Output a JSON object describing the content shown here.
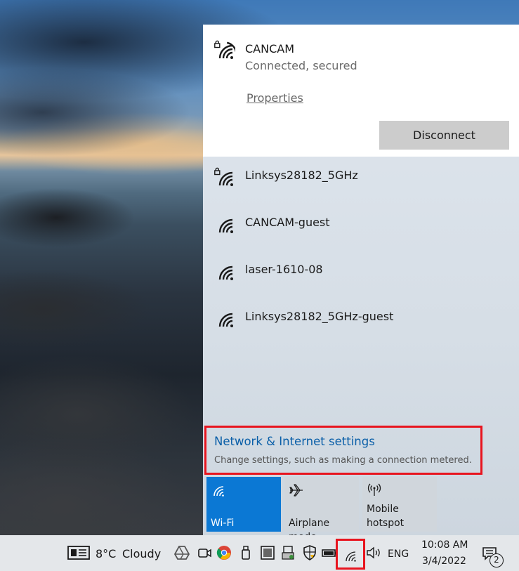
{
  "connected": {
    "ssid": "CANCAM",
    "status": "Connected, secured",
    "properties_label": "Properties",
    "disconnect_label": "Disconnect"
  },
  "networks": [
    {
      "ssid": "Linksys28182_5GHz",
      "secured": true
    },
    {
      "ssid": "CANCAM-guest",
      "secured": false
    },
    {
      "ssid": "laser-1610-08",
      "secured": false
    },
    {
      "ssid": "Linksys28182_5GHz-guest",
      "secured": false
    }
  ],
  "settings": {
    "title": "Network & Internet settings",
    "subtitle": "Change settings, such as making a connection metered."
  },
  "quick_actions": [
    {
      "label": "Wi-Fi",
      "label2": "",
      "icon": "wifi-icon",
      "active": true
    },
    {
      "label": "Airplane mode",
      "label2": "",
      "icon": "airplane-icon",
      "active": false
    },
    {
      "label": "Mobile",
      "label2": "hotspot",
      "icon": "hotspot-icon",
      "active": false
    }
  ],
  "taskbar": {
    "weather_temp": "8°C",
    "weather_text": "Cloudy",
    "language": "ENG",
    "time": "10:08 AM",
    "date": "3/4/2022",
    "notification_count": "2"
  },
  "colors": {
    "accent": "#0b78d4",
    "highlight": "#e8141e",
    "link": "#0a5fa8"
  }
}
